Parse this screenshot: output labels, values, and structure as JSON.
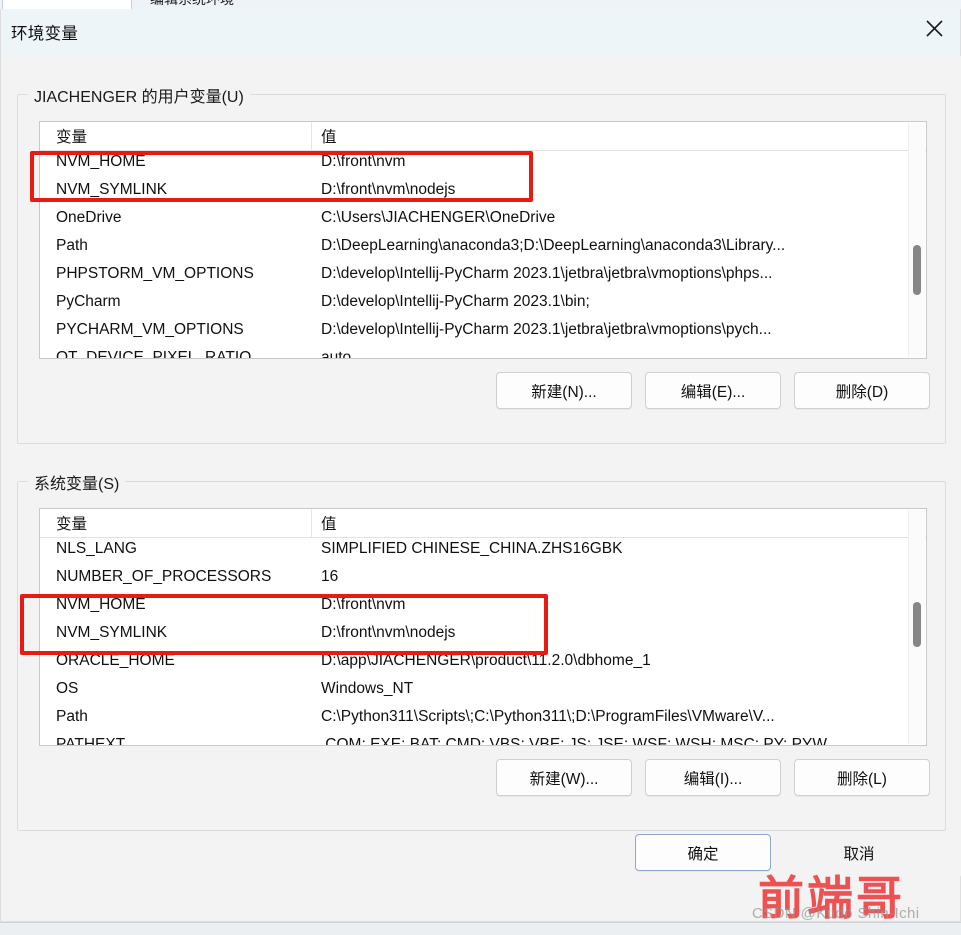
{
  "background_window": {
    "title_fragment": "编辑系统环境"
  },
  "dialog": {
    "title": "环境变量",
    "close_icon": "close-icon"
  },
  "user_section": {
    "legend": "JIACHENGER 的用户变量(U)",
    "columns": {
      "name": "变量",
      "value": "值"
    },
    "rows": [
      {
        "name": "NVM_HOME",
        "value": "D:\\front\\nvm"
      },
      {
        "name": "NVM_SYMLINK",
        "value": "D:\\front\\nvm\\nodejs"
      },
      {
        "name": "OneDrive",
        "value": "C:\\Users\\JIACHENGER\\OneDrive"
      },
      {
        "name": "Path",
        "value": "D:\\DeepLearning\\anaconda3;D:\\DeepLearning\\anaconda3\\Library..."
      },
      {
        "name": "PHPSTORM_VM_OPTIONS",
        "value": "D:\\develop\\Intellij-PyCharm 2023.1\\jetbra\\jetbra\\vmoptions\\phps..."
      },
      {
        "name": "PyCharm",
        "value": "D:\\develop\\Intellij-PyCharm 2023.1\\bin;"
      },
      {
        "name": "PYCHARM_VM_OPTIONS",
        "value": "D:\\develop\\Intellij-PyCharm 2023.1\\jetbra\\jetbra\\vmoptions\\pych..."
      },
      {
        "name": "QT_DEVICE_PIXEL_RATIO",
        "value": "auto"
      }
    ],
    "buttons": {
      "new": "新建(N)...",
      "edit": "编辑(E)...",
      "delete": "删除(D)"
    }
  },
  "system_section": {
    "legend": "系统变量(S)",
    "columns": {
      "name": "变量",
      "value": "值"
    },
    "rows": [
      {
        "name": "NLS_LANG",
        "value": "SIMPLIFIED CHINESE_CHINA.ZHS16GBK"
      },
      {
        "name": "NUMBER_OF_PROCESSORS",
        "value": "16"
      },
      {
        "name": "NVM_HOME",
        "value": "D:\\front\\nvm"
      },
      {
        "name": "NVM_SYMLINK",
        "value": "D:\\front\\nvm\\nodejs"
      },
      {
        "name": "ORACLE_HOME",
        "value": "D:\\app\\JIACHENGER\\product\\11.2.0\\dbhome_1"
      },
      {
        "name": "OS",
        "value": "Windows_NT"
      },
      {
        "name": "Path",
        "value": "C:\\Python311\\Scripts\\;C:\\Python311\\;D:\\ProgramFiles\\VMware\\V..."
      },
      {
        "name": "PATHEXT",
        "value": ".COM;.EXE;.BAT;.CMD;.VBS;.VBE;.JS;.JSE;.WSF;.WSH;.MSC;.PY;.PYW"
      }
    ],
    "buttons": {
      "new": "新建(W)...",
      "edit": "编辑(I)...",
      "delete": "删除(L)"
    }
  },
  "footer": {
    "ok": "确定",
    "cancel": "取消"
  },
  "annotations": {
    "highlight_color": "#e81b14",
    "watermark": "前端哥",
    "watermark_credit": "CSDN @Kudo Shin-Ichi"
  }
}
